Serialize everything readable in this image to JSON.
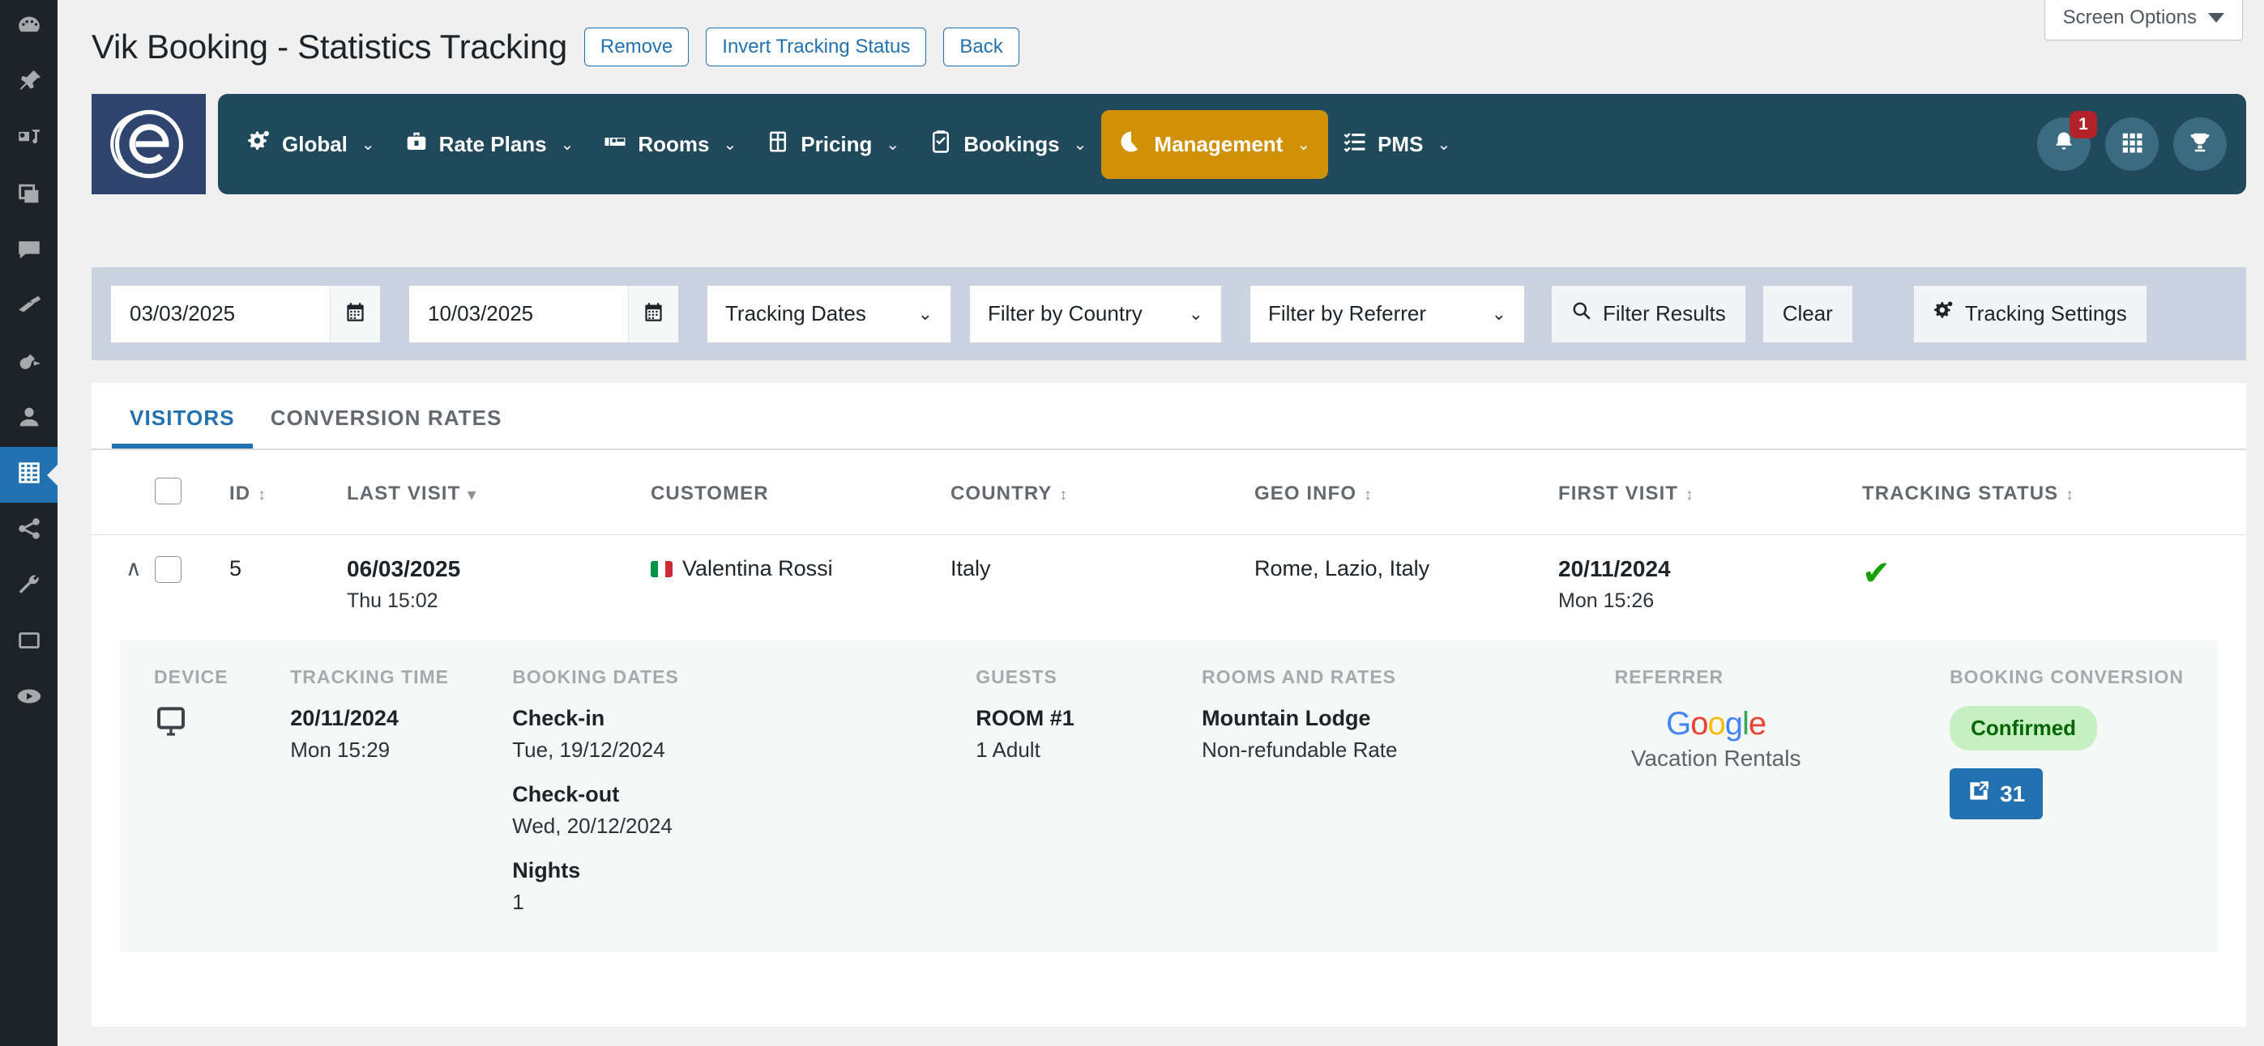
{
  "screen_options": {
    "label": "Screen Options",
    "icon": "chevron-down-icon"
  },
  "page": {
    "title": "Vik Booking - Statistics Tracking",
    "buttons": [
      {
        "label": "Remove",
        "name": "remove-button"
      },
      {
        "label": "Invert Tracking Status",
        "name": "invert-tracking-status-button"
      },
      {
        "label": "Back",
        "name": "back-button"
      }
    ]
  },
  "brand": {
    "logo_letter": "e",
    "logo_bg": "#2f456e"
  },
  "nav": {
    "accent": "#d19106",
    "bg": "#21495c",
    "items": [
      {
        "label": "Global",
        "icon": "gears-icon",
        "active": false
      },
      {
        "label": "Rate Plans",
        "icon": "briefcase-icon",
        "active": false
      },
      {
        "label": "Rooms",
        "icon": "bed-icon",
        "active": false
      },
      {
        "label": "Pricing",
        "icon": "calculator-icon",
        "active": false
      },
      {
        "label": "Bookings",
        "icon": "checklist-icon",
        "active": false
      },
      {
        "label": "Management",
        "icon": "piechart-icon",
        "active": true
      },
      {
        "label": "PMS",
        "icon": "tasklist-icon",
        "active": false
      }
    ],
    "chevron": "⌄",
    "actions": [
      {
        "name": "notifications-bell-icon",
        "icon": "bell-icon",
        "badge": "1"
      },
      {
        "name": "apps-grid-icon",
        "icon": "grid-icon",
        "badge": ""
      },
      {
        "name": "trophy-icon",
        "icon": "trophy-icon",
        "badge": ""
      }
    ]
  },
  "filters": {
    "bg": "#ccd3e0",
    "date_from": {
      "value": "03/03/2025",
      "icon": "calendar-icon"
    },
    "date_to": {
      "value": "10/03/2025",
      "icon": "calendar-icon"
    },
    "tracking_dates": {
      "value": "Tracking Dates",
      "chevron": "⌄"
    },
    "filter_country": {
      "value": "Filter by Country",
      "chevron": "⌄"
    },
    "filter_referrer": {
      "value": "Filter by Referrer",
      "chevron": "⌄"
    },
    "filter_results": {
      "label": "Filter Results",
      "icon": "search-icon"
    },
    "clear": {
      "label": "Clear"
    },
    "tracking_settings": {
      "label": "Tracking Settings",
      "icon": "gears-icon"
    }
  },
  "tabs": [
    {
      "label": "VISITORS",
      "active": true
    },
    {
      "label": "CONVERSION RATES",
      "active": false
    }
  ],
  "table": {
    "columns": [
      {
        "label": "",
        "sort": "",
        "name": "select-all-column"
      },
      {
        "label": "ID",
        "sort": "↕",
        "name": "id-column"
      },
      {
        "label": "LAST VISIT",
        "sort": "▾",
        "name": "last-visit-column"
      },
      {
        "label": "CUSTOMER",
        "sort": "",
        "name": "customer-column"
      },
      {
        "label": "COUNTRY",
        "sort": "↕",
        "name": "country-column"
      },
      {
        "label": "GEO INFO",
        "sort": "↕",
        "name": "geo-info-column"
      },
      {
        "label": "FIRST VISIT",
        "sort": "↕",
        "name": "first-visit-column"
      },
      {
        "label": "TRACKING STATUS",
        "sort": "↕",
        "name": "tracking-status-column"
      }
    ],
    "rows": [
      {
        "expanded": true,
        "expand_icon": "∧",
        "id": "5",
        "last_visit_date": "06/03/2025",
        "last_visit_time": "Thu 15:02",
        "customer": "Valentina Rossi",
        "customer_flag": "italy-flag",
        "country": "Italy",
        "geo_info": "Rome, Lazio, Italy",
        "first_visit_date": "20/11/2024",
        "first_visit_time": "Mon 15:26",
        "tracking_status_icon": "check-icon"
      }
    ]
  },
  "detail": {
    "device": {
      "label": "DEVICE",
      "icon": "desktop-monitor-icon"
    },
    "tracking_time": {
      "label": "TRACKING TIME",
      "date": "20/11/2024",
      "time": "Mon 15:29"
    },
    "booking_dates": {
      "label": "BOOKING DATES",
      "checkin_label": "Check-in",
      "checkin_value": "Tue, 19/12/2024",
      "checkout_label": "Check-out",
      "checkout_value": "Wed, 20/12/2024",
      "nights_label": "Nights",
      "nights_value": "1"
    },
    "guests": {
      "label": "GUESTS",
      "room": "ROOM #1",
      "occupancy": "1 Adult"
    },
    "rooms_and_rates": {
      "label": "ROOMS AND RATES",
      "room": "Mountain Lodge",
      "rate": "Non-refundable Rate"
    },
    "referrer": {
      "label": "REFERRER",
      "brand": "Google",
      "sub": "Vacation Rentals"
    },
    "booking_conversion": {
      "label": "BOOKING CONVERSION",
      "status": "Confirmed",
      "status_bg": "#c6f0c2",
      "status_color": "#006400",
      "link_number": "31",
      "link_icon": "external-link-icon"
    }
  },
  "sidebar": {
    "items": [
      {
        "name": "sidebar-item-dashboard",
        "icon": "dashboard-icon",
        "active": false
      },
      {
        "name": "sidebar-item-posts",
        "icon": "pin-icon",
        "active": false
      },
      {
        "name": "sidebar-item-media",
        "icon": "media-icon",
        "active": false
      },
      {
        "name": "sidebar-item-pages",
        "icon": "pages-icon",
        "active": false
      },
      {
        "name": "sidebar-item-comments",
        "icon": "comment-icon",
        "active": false
      },
      {
        "name": "sidebar-item-appearance",
        "icon": "brush-icon",
        "active": false
      },
      {
        "name": "sidebar-item-plugins",
        "icon": "plug-icon",
        "active": false
      },
      {
        "name": "sidebar-item-users",
        "icon": "user-icon",
        "active": false
      },
      {
        "name": "sidebar-item-vikbooking",
        "icon": "building-icon",
        "active": true
      },
      {
        "name": "sidebar-item-share",
        "icon": "share-icon",
        "active": false
      },
      {
        "name": "sidebar-item-tools",
        "icon": "wrench-icon",
        "active": false
      },
      {
        "name": "sidebar-item-settings",
        "icon": "sliders-icon",
        "active": false
      },
      {
        "name": "sidebar-item-collapse",
        "icon": "play-circle-icon",
        "active": false
      }
    ]
  }
}
